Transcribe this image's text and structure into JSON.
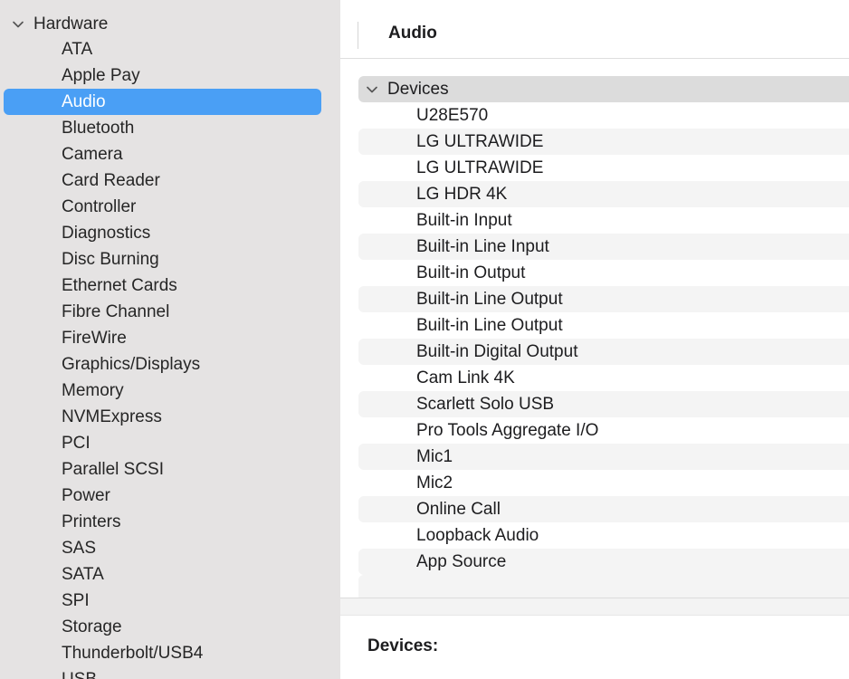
{
  "sidebar": {
    "group_label": "Hardware",
    "selected_index": 2,
    "items": [
      "ATA",
      "Apple Pay",
      "Audio",
      "Bluetooth",
      "Camera",
      "Card Reader",
      "Controller",
      "Diagnostics",
      "Disc Burning",
      "Ethernet Cards",
      "Fibre Channel",
      "FireWire",
      "Graphics/Displays",
      "Memory",
      "NVMExpress",
      "PCI",
      "Parallel SCSI",
      "Power",
      "Printers",
      "SAS",
      "SATA",
      "SPI",
      "Storage",
      "Thunderbolt/USB4",
      "USB"
    ]
  },
  "main": {
    "column_title": "Audio",
    "tree": {
      "group_label": "Devices",
      "devices": [
        "U28E570",
        "LG ULTRAWIDE",
        "LG ULTRAWIDE",
        "LG HDR 4K",
        "Built-in Input",
        "Built-in Line Input",
        "Built-in Output",
        "Built-in Line Output",
        "Built-in Line Output",
        "Built-in Digital Output",
        "Cam Link 4K",
        "Scarlett Solo USB",
        "Pro Tools Aggregate I/O",
        "Mic1",
        "Mic2",
        "Online Call",
        "Loopback Audio",
        "App Source"
      ]
    },
    "detail": {
      "title": "Devices:"
    }
  },
  "colors": {
    "sidebar_bg": "#e5e3e3",
    "selection_accent": "#4a9ff5",
    "group_row_bg": "#dcdcdc",
    "alt_row_bg": "#f4f4f4"
  },
  "icons": {
    "disclosure": "chevron-down-icon"
  }
}
